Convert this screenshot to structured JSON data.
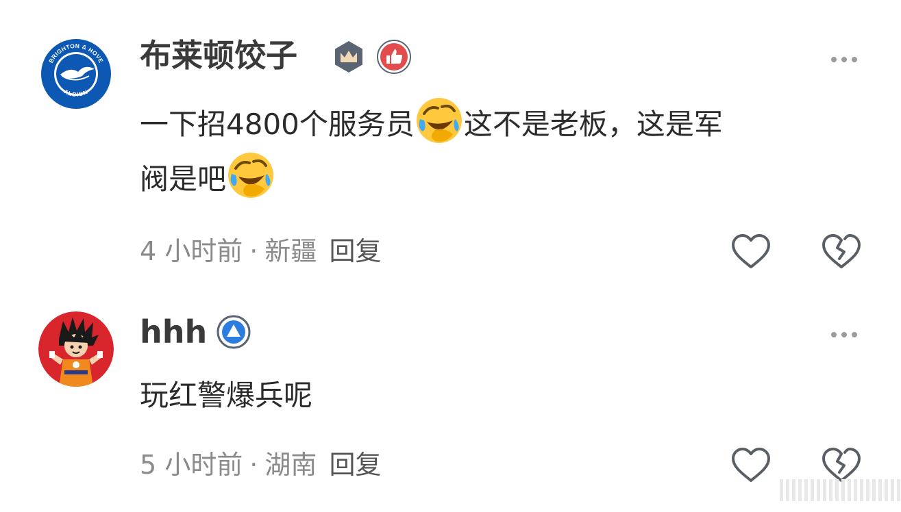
{
  "comments": [
    {
      "username": "布莱顿饺子",
      "avatar": "brighton-albion-crest",
      "avatar_text": [
        "BRIGHTON & HOVE",
        "ALBION"
      ],
      "badges": [
        "crown-badge-icon",
        "thumbs-up-badge-icon"
      ],
      "text_line1_a": "一下招4800个服务员",
      "text_line1_b": "这不是老板，这是军",
      "text_line2": "阀是吧",
      "emoji": "laugh-cry-emoji",
      "time": "4 小时前",
      "location": "新疆",
      "reply_label": "回复"
    },
    {
      "username": "hhh",
      "avatar": "goku-avatar",
      "badges": [
        "triangle-badge-icon"
      ],
      "text": "玩红警爆兵呢",
      "time": "5 小时前",
      "location": "湖南",
      "reply_label": "回复"
    }
  ],
  "meta_separator": "·",
  "colors": {
    "brighton_blue": "#0d58b3",
    "badge_red": "#e34c4c",
    "badge_dark": "#5b6472",
    "badge_blue": "#2d7de1",
    "goku_bg": "#d8262c",
    "meta_gray": "#8a8a8a",
    "icon_gray": "#5a5f66"
  }
}
